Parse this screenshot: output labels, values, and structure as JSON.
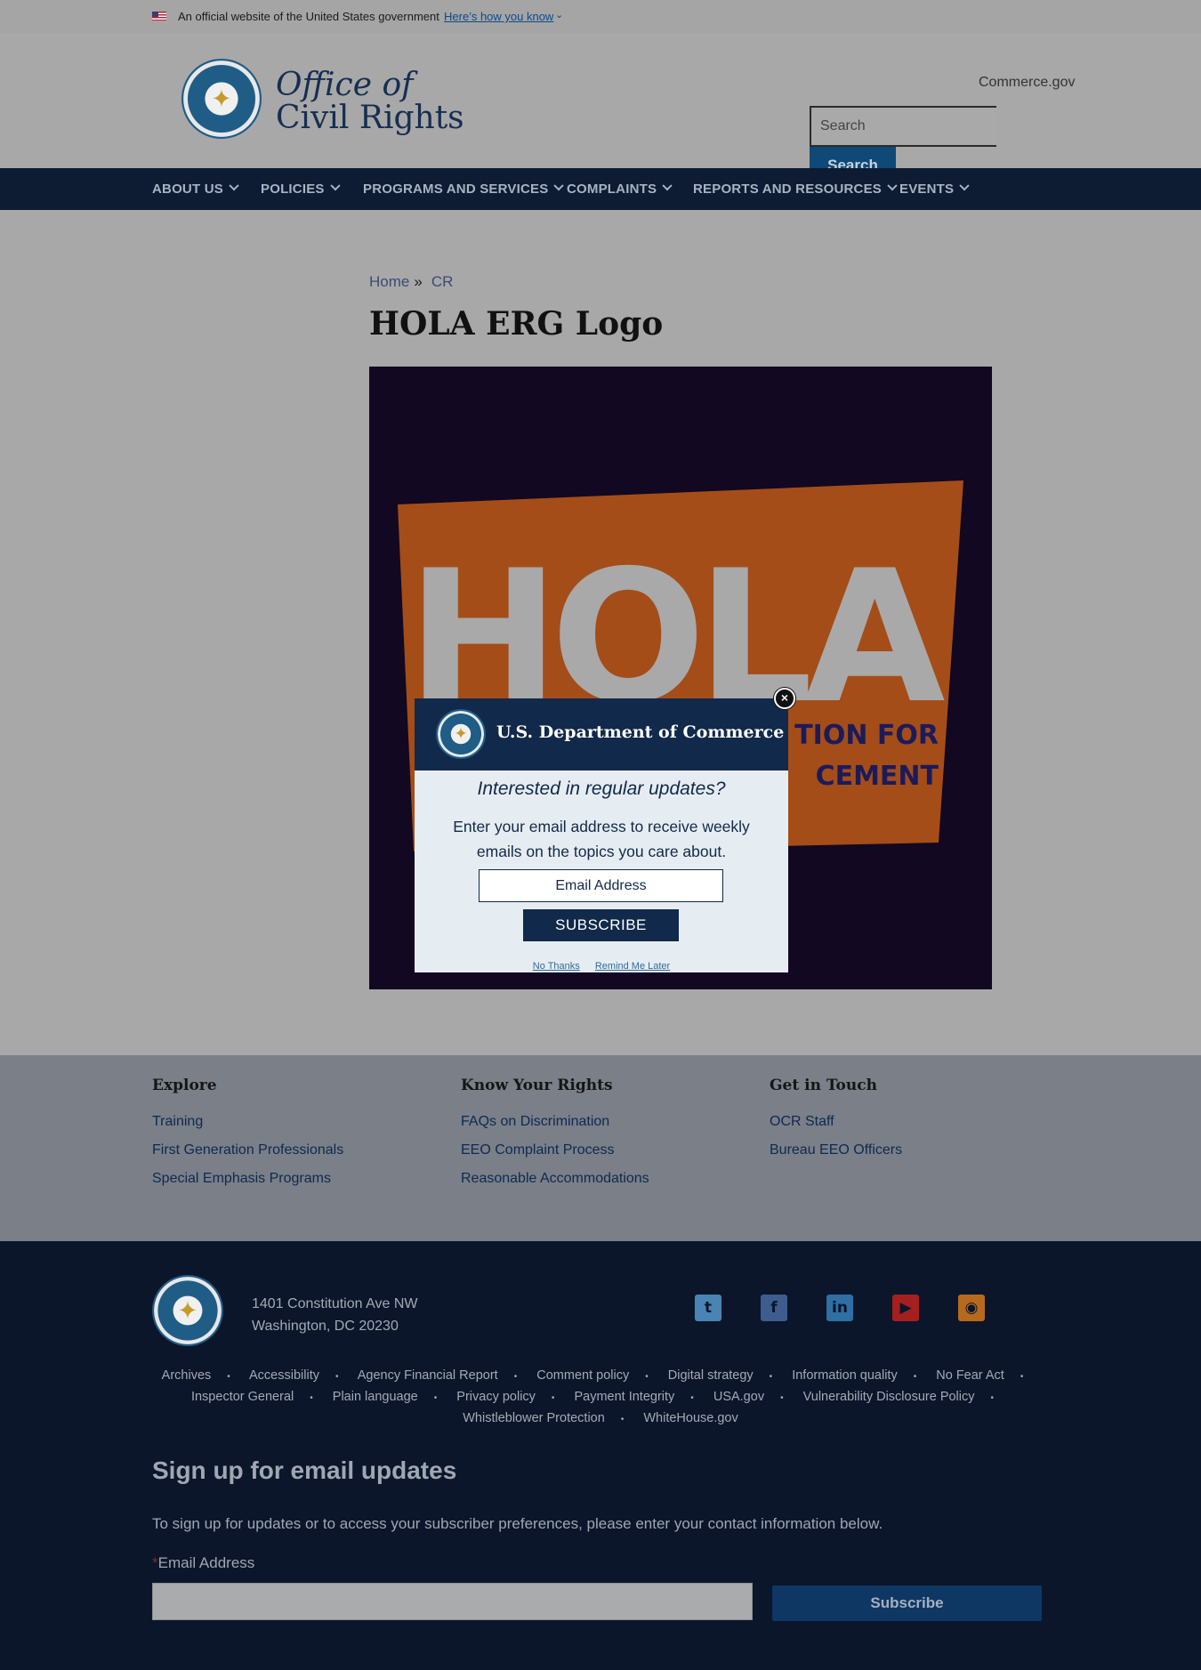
{
  "gov_banner": {
    "official_text": "An official website of the United States government",
    "how_you_know": "Here’s how you know"
  },
  "header": {
    "title_line1": "Office of",
    "title_line2": "Civil Rights",
    "commerce_link": "Commerce.gov",
    "search_placeholder": "Search",
    "search_button": "Search"
  },
  "nav": {
    "items": [
      {
        "label": "ABOUT US"
      },
      {
        "label": "POLICIES"
      },
      {
        "label": "PROGRAMS AND SERVICES"
      },
      {
        "label": "COMPLAINTS"
      },
      {
        "label": "REPORTS AND RESOURCES"
      },
      {
        "label": "EVENTS"
      }
    ]
  },
  "breadcrumb": {
    "home": "Home",
    "separator": "»",
    "current": "CR"
  },
  "page": {
    "title": "HOLA ERG Logo",
    "image_text_main": "HOLA",
    "image_text_sub1": "TION FOR",
    "image_text_sub2": "CEMENT"
  },
  "colors": {
    "nav_bg": "#0d1b33",
    "modal_head": "#11294a",
    "logo_orange": "#c2571a",
    "logo_bg": "#120821"
  },
  "modal": {
    "org": "U.S. Department of Commerce",
    "question": "Interested in regular updates?",
    "description": "Enter your email address to receive weekly emails on the topics you care about.",
    "email_placeholder": "Email Address",
    "subscribe": "SUBSCRIBE",
    "no_thanks": "No Thanks",
    "remind_later": "Remind Me Later",
    "close_icon": "close-icon"
  },
  "footer_links": {
    "explore": {
      "title": "Explore",
      "links": [
        "Training",
        "First Generation Professionals",
        "Special Emphasis Programs"
      ]
    },
    "rights": {
      "title": "Know Your Rights",
      "links": [
        "FAQs on Discrimination",
        "EEO Complaint Process",
        "Reasonable Accommodations"
      ]
    },
    "touch": {
      "title": "Get in Touch",
      "links": [
        "OCR Staff",
        "Bureau EEO Officers"
      ]
    }
  },
  "footer": {
    "address_line1": "1401 Constitution Ave NW",
    "address_line2": "Washington, DC 20230",
    "social": [
      "twitter-icon",
      "facebook-icon",
      "linkedin-icon",
      "youtube-icon",
      "rss-icon"
    ],
    "legal": [
      "Archives",
      "Accessibility",
      "Agency Financial Report",
      "Comment policy",
      "Digital strategy",
      "Information quality",
      "No Fear Act",
      "Inspector General",
      "Plain language",
      "Privacy policy",
      "Payment Integrity",
      "USA.gov",
      "Vulnerability Disclosure Policy",
      "Whistleblower Protection",
      "WhiteHouse.gov"
    ],
    "signup_title": "Sign up for email updates",
    "signup_desc": "To sign up for updates or to access your subscriber preferences, please enter your contact information below.",
    "required_mark": "*",
    "email_label": "Email Address",
    "subscribe": "Subscribe"
  }
}
